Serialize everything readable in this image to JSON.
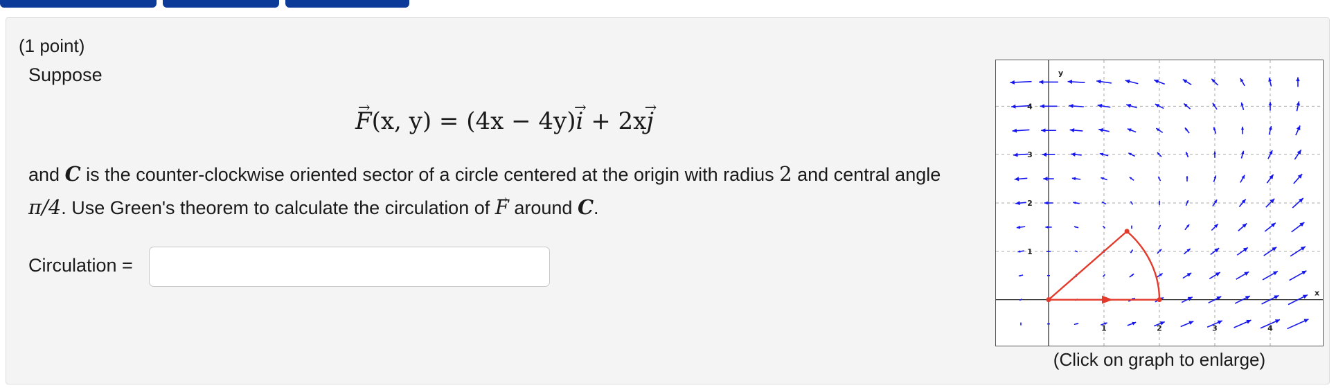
{
  "top_buttons": [
    {
      "label": ""
    },
    {
      "label": ""
    },
    {
      "label": ""
    }
  ],
  "problem": {
    "points": "(1 point)",
    "intro": "Suppose",
    "equation": {
      "lhs_func": "F",
      "lhs_args": "(x, y) = (4x − 4y)",
      "i_unit": "i",
      "middle": " + 2x",
      "j_unit": "j"
    },
    "text_part1": "and ",
    "curve_symbol": "C",
    "text_part2": " is the counter-clockwise oriented sector of a circle centered at the origin with radius ",
    "radius": "2",
    "text_part3": " and central angle ",
    "angle": "π/4",
    "text_part4": ". Use Green's theorem to calculate the circulation of ",
    "field_symbol": "F",
    "text_part5": " around ",
    "curve_symbol2": "C",
    "text_part6": "."
  },
  "answer": {
    "label": "Circulation =",
    "value": "",
    "placeholder": ""
  },
  "graph": {
    "y_axis_label": "y",
    "x_axis_label": "x",
    "x_ticks": [
      "1",
      "2",
      "3",
      "4"
    ],
    "y_ticks": [
      "1",
      "2",
      "3",
      "4"
    ],
    "caption": "(Click on graph to enlarge)",
    "field_color": "#1515ee",
    "curve_color": "#e33a2b",
    "field": "F = (4x − 4y, 2x)",
    "x_range": [
      -0.95,
      4.95
    ],
    "y_range": [
      -0.95,
      4.95
    ],
    "sector": {
      "radius": 2,
      "angle_deg": 45
    }
  }
}
